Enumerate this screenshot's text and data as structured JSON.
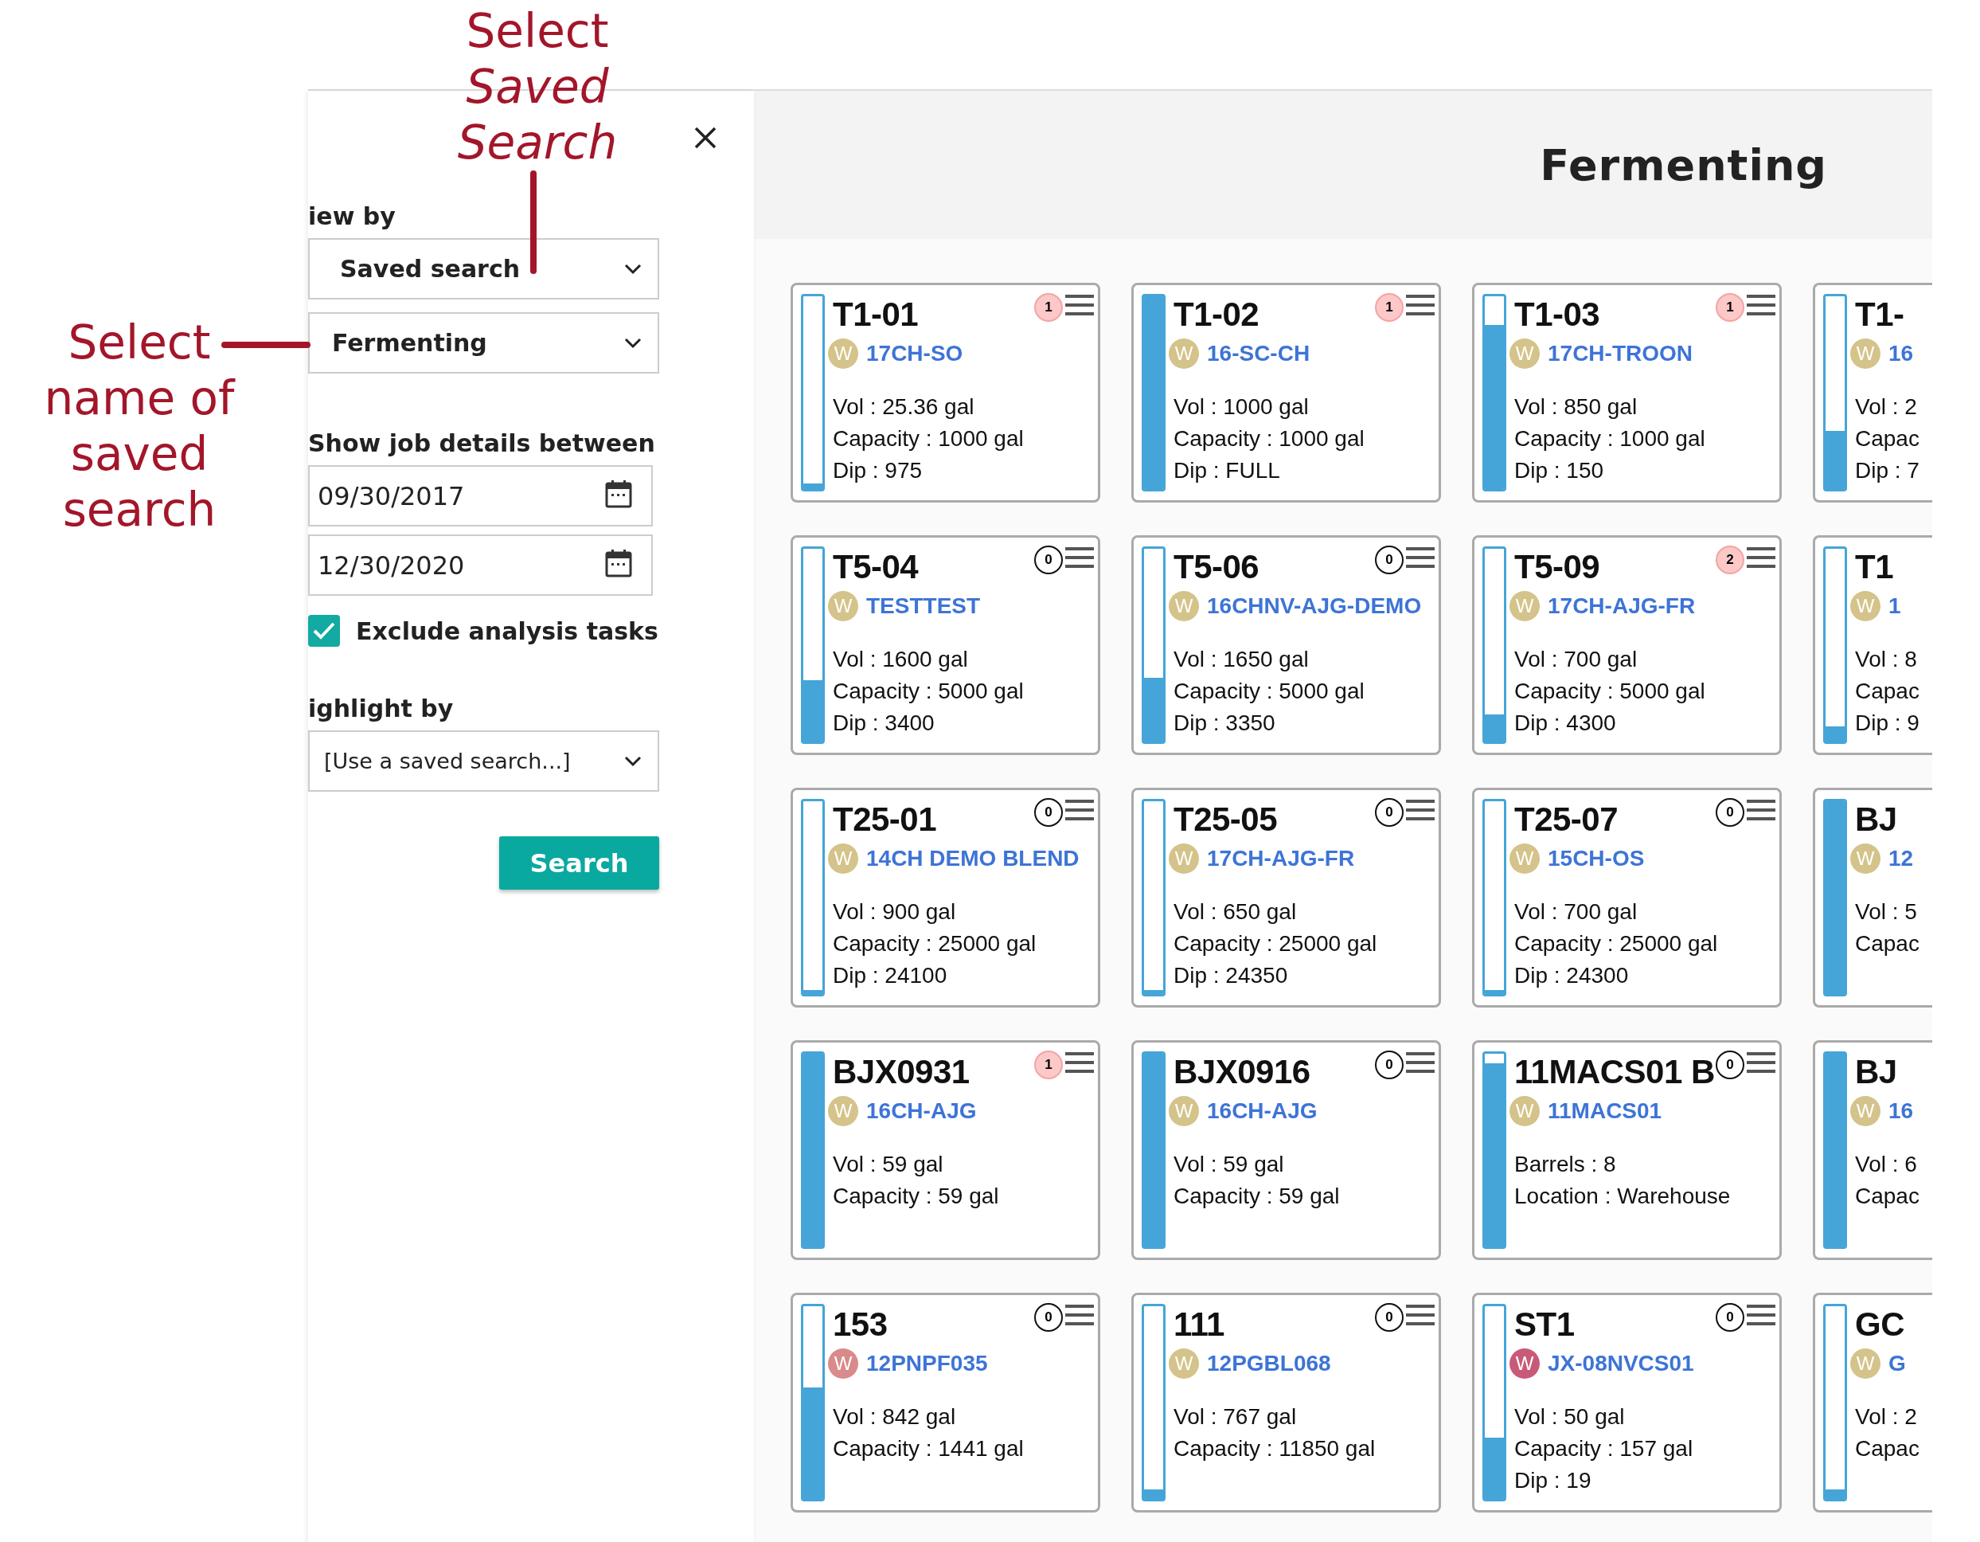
{
  "annotations": [
    {
      "kind": "top",
      "text": "Select *Saved Search*"
    },
    {
      "kind": "left",
      "text": "Select name of saved search"
    }
  ],
  "panel": {
    "view_by_label": "iew by",
    "view_by": "Saved search",
    "saved_search": "Fermenting",
    "dates_label": "Show job details between",
    "date_from": "09/30/2017",
    "date_to": "12/30/2020",
    "exclude": {
      "label": "Exclude analysis tasks",
      "checked": true
    },
    "highlight_label": "ighlight by",
    "highlight": "[Use a saved search...]",
    "search_button": "Search"
  },
  "main": {
    "title": "Fermenting",
    "cards": [
      {
        "kind": "full",
        "name": "T1-01",
        "avatar": "W",
        "color": "#d4c38a",
        "batch": "17CH-SO",
        "badge": "1",
        "alert": true,
        "level": 0.03,
        "details": [
          "Vol : 25.36 gal",
          "Capacity : 1000 gal",
          "Dip : 975"
        ]
      },
      {
        "kind": "full",
        "name": "T1-02",
        "avatar": "W",
        "color": "#d4c38a",
        "batch": "16-SC-CH",
        "badge": "1",
        "alert": true,
        "level": 1,
        "details": [
          "Vol : 1000 gal",
          "Capacity : 1000 gal",
          "Dip : FULL"
        ]
      },
      {
        "kind": "full",
        "name": "T1-03",
        "avatar": "W",
        "color": "#d4c38a",
        "batch": "17CH-TROON",
        "badge": "1",
        "alert": true,
        "level": 0.85,
        "details": [
          "Vol : 850 gal",
          "Capacity : 1000 gal",
          "Dip : 150"
        ]
      },
      {
        "kind": "partial",
        "name": "T1-",
        "avatar": "W",
        "color": "#d4c38a",
        "batch": "16",
        "level": 0.3,
        "details": [
          "Vol : 2",
          "Capac",
          "Dip : 7"
        ]
      },
      {
        "kind": "full",
        "name": "T5-04",
        "avatar": "W",
        "color": "#d4c38a",
        "batch": "TESTTEST",
        "badge": "0",
        "alert": false,
        "level": 0.32,
        "details": [
          "Vol : 1600 gal",
          "Capacity : 5000 gal",
          "Dip : 3400"
        ]
      },
      {
        "kind": "full",
        "name": "T5-06",
        "avatar": "W",
        "color": "#d4c38a",
        "batch": "16CHNV-AJG-DEMO",
        "badge": "0",
        "alert": false,
        "level": 0.33,
        "details": [
          "Vol : 1650 gal",
          "Capacity : 5000 gal",
          "Dip : 3350"
        ]
      },
      {
        "kind": "full",
        "name": "T5-09",
        "avatar": "W",
        "color": "#d4c38a",
        "batch": "17CH-AJG-FR",
        "badge": "2",
        "alert": true,
        "level": 0.14,
        "details": [
          "Vol : 700 gal",
          "Capacity : 5000 gal",
          "Dip : 4300"
        ]
      },
      {
        "kind": "partial",
        "name": "T1",
        "avatar": "W",
        "color": "#d4c38a",
        "batch": "1",
        "level": 0.08,
        "details": [
          "Vol : 8",
          "Capac",
          "Dip : 9"
        ]
      },
      {
        "kind": "full",
        "name": "T25-01",
        "avatar": "W",
        "color": "#d4c38a",
        "batch": "14CH DEMO BLEND",
        "badge": "0",
        "alert": false,
        "level": 0.02,
        "details": [
          "Vol : 900 gal",
          "Capacity : 25000 gal",
          "Dip : 24100"
        ]
      },
      {
        "kind": "full",
        "name": "T25-05",
        "avatar": "W",
        "color": "#d4c38a",
        "batch": "17CH-AJG-FR",
        "badge": "0",
        "alert": false,
        "level": 0.02,
        "details": [
          "Vol : 650 gal",
          "Capacity : 25000 gal",
          "Dip : 24350"
        ]
      },
      {
        "kind": "full",
        "name": "T25-07",
        "avatar": "W",
        "color": "#d4c38a",
        "batch": "15CH-OS",
        "badge": "0",
        "alert": false,
        "level": 0.02,
        "details": [
          "Vol : 700 gal",
          "Capacity : 25000 gal",
          "Dip : 24300"
        ]
      },
      {
        "kind": "partial",
        "name": "BJ",
        "avatar": "W",
        "color": "#d4c38a",
        "batch": "12",
        "level": 1,
        "details": [
          "Vol : 5",
          "Capac"
        ]
      },
      {
        "kind": "full",
        "name": "BJX0931",
        "avatar": "W",
        "color": "#d4c38a",
        "batch": "16CH-AJG",
        "badge": "1",
        "alert": true,
        "level": 1,
        "details": [
          "Vol : 59 gal",
          "Capacity : 59 gal"
        ]
      },
      {
        "kind": "full",
        "name": "BJX0916",
        "avatar": "W",
        "color": "#d4c38a",
        "batch": "16CH-AJG",
        "badge": "0",
        "alert": false,
        "level": 1,
        "details": [
          "Vol : 59 gal",
          "Capacity : 59 gal"
        ]
      },
      {
        "kind": "full",
        "name": "11MACS01 B",
        "avatar": "W",
        "color": "#d4c38a",
        "batch": "11MACS01",
        "badge": "0",
        "alert": false,
        "level": 0.95,
        "details": [
          "Barrels : 8",
          "Location : Warehouse"
        ]
      },
      {
        "kind": "partial",
        "name": "BJ",
        "avatar": "W",
        "color": "#d4c38a",
        "batch": "16",
        "level": 1,
        "details": [
          "Vol : 6",
          "Capac"
        ]
      },
      {
        "kind": "full",
        "name": "153",
        "avatar": "W",
        "color": "#d98a8a",
        "batch": "12PNPF035",
        "badge": "0",
        "alert": false,
        "level": 0.58,
        "details": [
          "Vol : 842 gal",
          "Capacity : 1441 gal"
        ]
      },
      {
        "kind": "full",
        "name": "111",
        "avatar": "W",
        "color": "#d4c38a",
        "batch": "12PGBL068",
        "badge": "0",
        "alert": false,
        "level": 0.05,
        "details": [
          "Vol : 767 gal",
          "Capacity : 11850 gal"
        ]
      },
      {
        "kind": "full",
        "name": "ST1",
        "avatar": "W",
        "color": "#c85a78",
        "batch": "JX-08NVCS01",
        "badge": "0",
        "alert": false,
        "level": 0.32,
        "details": [
          "Vol : 50 gal",
          "Capacity : 157 gal",
          "Dip : 19"
        ]
      },
      {
        "kind": "partial",
        "name": "GC",
        "avatar": "W",
        "color": "#d4c38a",
        "batch": "G",
        "level": 0.05,
        "details": [
          "Vol : 2",
          "Capac"
        ]
      }
    ]
  }
}
